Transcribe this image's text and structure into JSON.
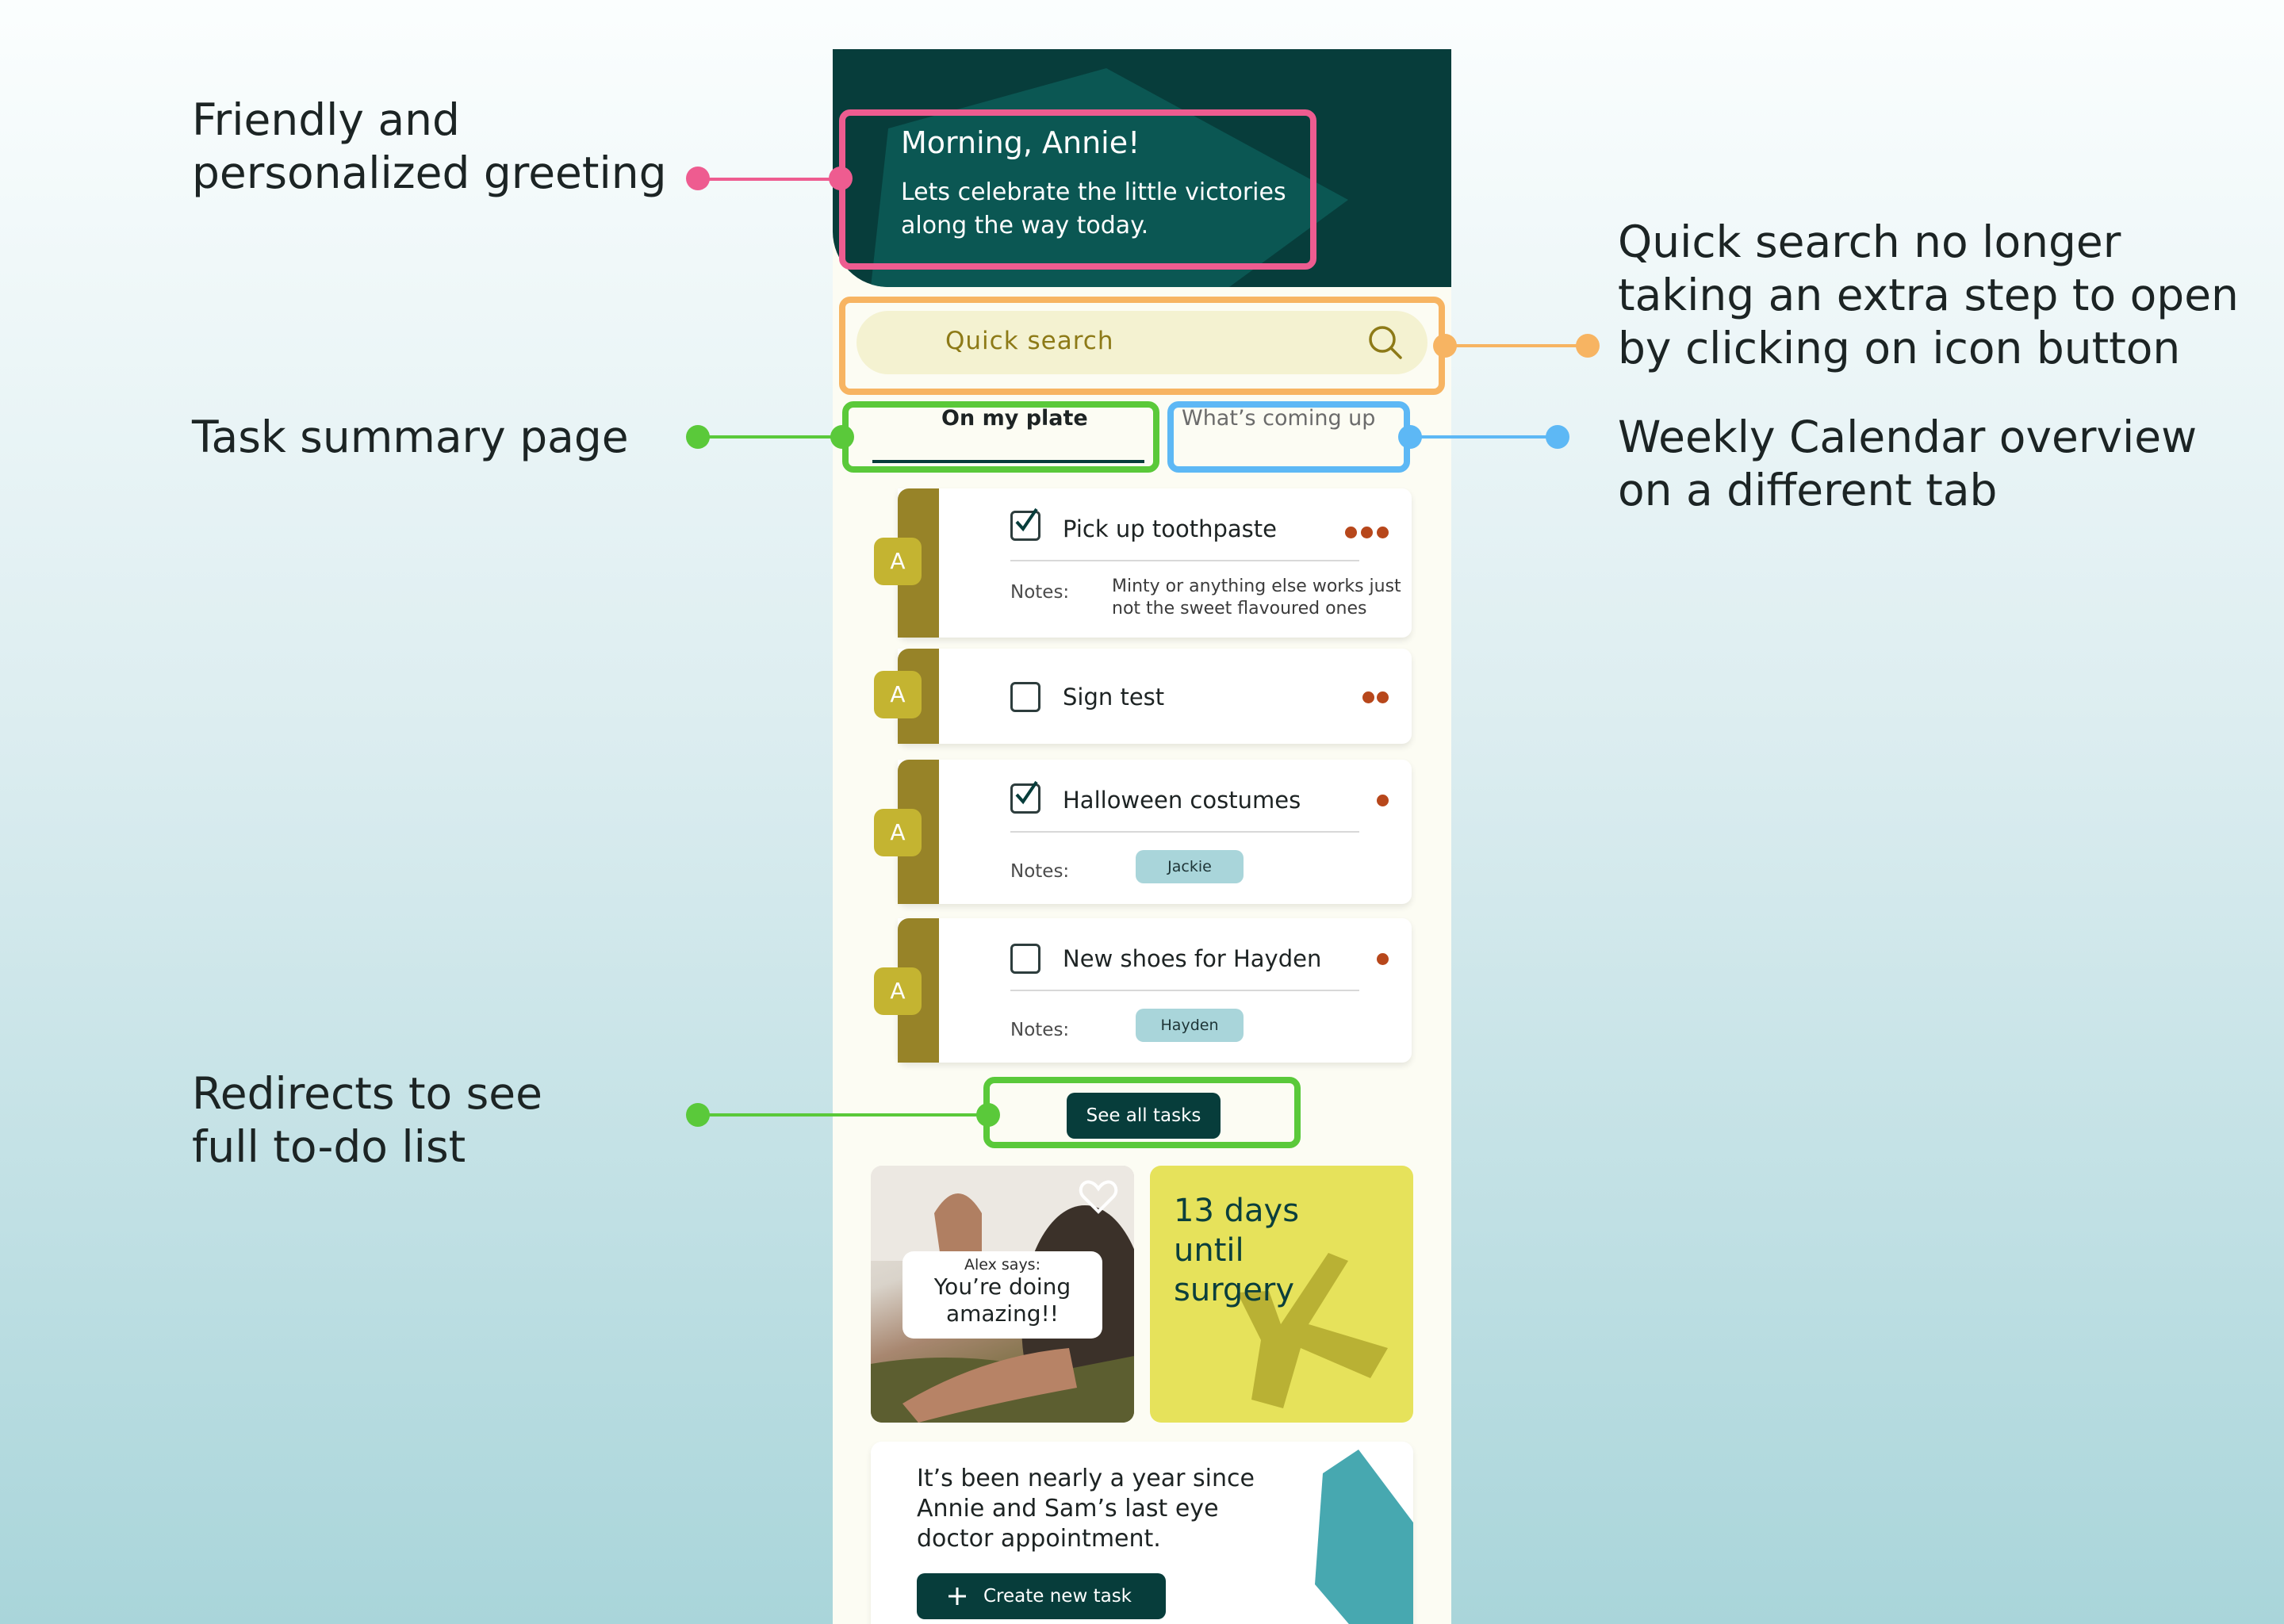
{
  "annotations": {
    "greeting": "Friendly and\npersonalized greeting",
    "search": "Quick search no longer\ntaking an extra step to open\nby clicking on icon button",
    "summary": "Task summary page",
    "calendar": "Weekly Calendar overview\non a different tab",
    "redirect": "Redirects to see\nfull to-do list"
  },
  "colors": {
    "annotation_pink": "#ee5c90",
    "annotation_orange": "#f7b462",
    "annotation_green": "#5ac93a",
    "annotation_blue": "#5db8f5",
    "header_bg": "#073d3b",
    "task_strip": "#978328",
    "priority_dot": "#b7471b"
  },
  "app": {
    "greeting": {
      "title": "Morning, Annie!",
      "subtitle": "Lets celebrate the little victories along the way today."
    },
    "search": {
      "placeholder": "Quick search",
      "icon": "search-icon"
    },
    "tabs": [
      {
        "label": "On my plate",
        "active": true
      },
      {
        "label": "What’s coming up",
        "active": false
      }
    ],
    "notes_label": "Notes:",
    "tasks": [
      {
        "avatar": "A",
        "title": "Pick up toothpaste",
        "checked": true,
        "priority": 3,
        "notes": "Minty or anything else works just not the sweet flavoured ones"
      },
      {
        "avatar": "A",
        "title": "Sign test",
        "checked": false,
        "priority": 2
      },
      {
        "avatar": "A",
        "title": "Halloween costumes",
        "checked": true,
        "priority": 1,
        "tag": "Jackie"
      },
      {
        "avatar": "A",
        "title": "New shoes for Hayden",
        "checked": false,
        "priority": 1,
        "tag": "Hayden"
      }
    ],
    "see_all": "See all tasks",
    "encouragement": {
      "author": "Alex says:",
      "message": "You’re doing amazing!!",
      "icon": "heart-icon"
    },
    "countdown": {
      "line1": "13 days",
      "line2": "until",
      "line3": "surgery"
    },
    "reminder": {
      "text": "It’s been nearly a year since Annie and Sam’s last eye doctor appointment.",
      "button": "Create new task",
      "icon": "plus-icon"
    }
  }
}
